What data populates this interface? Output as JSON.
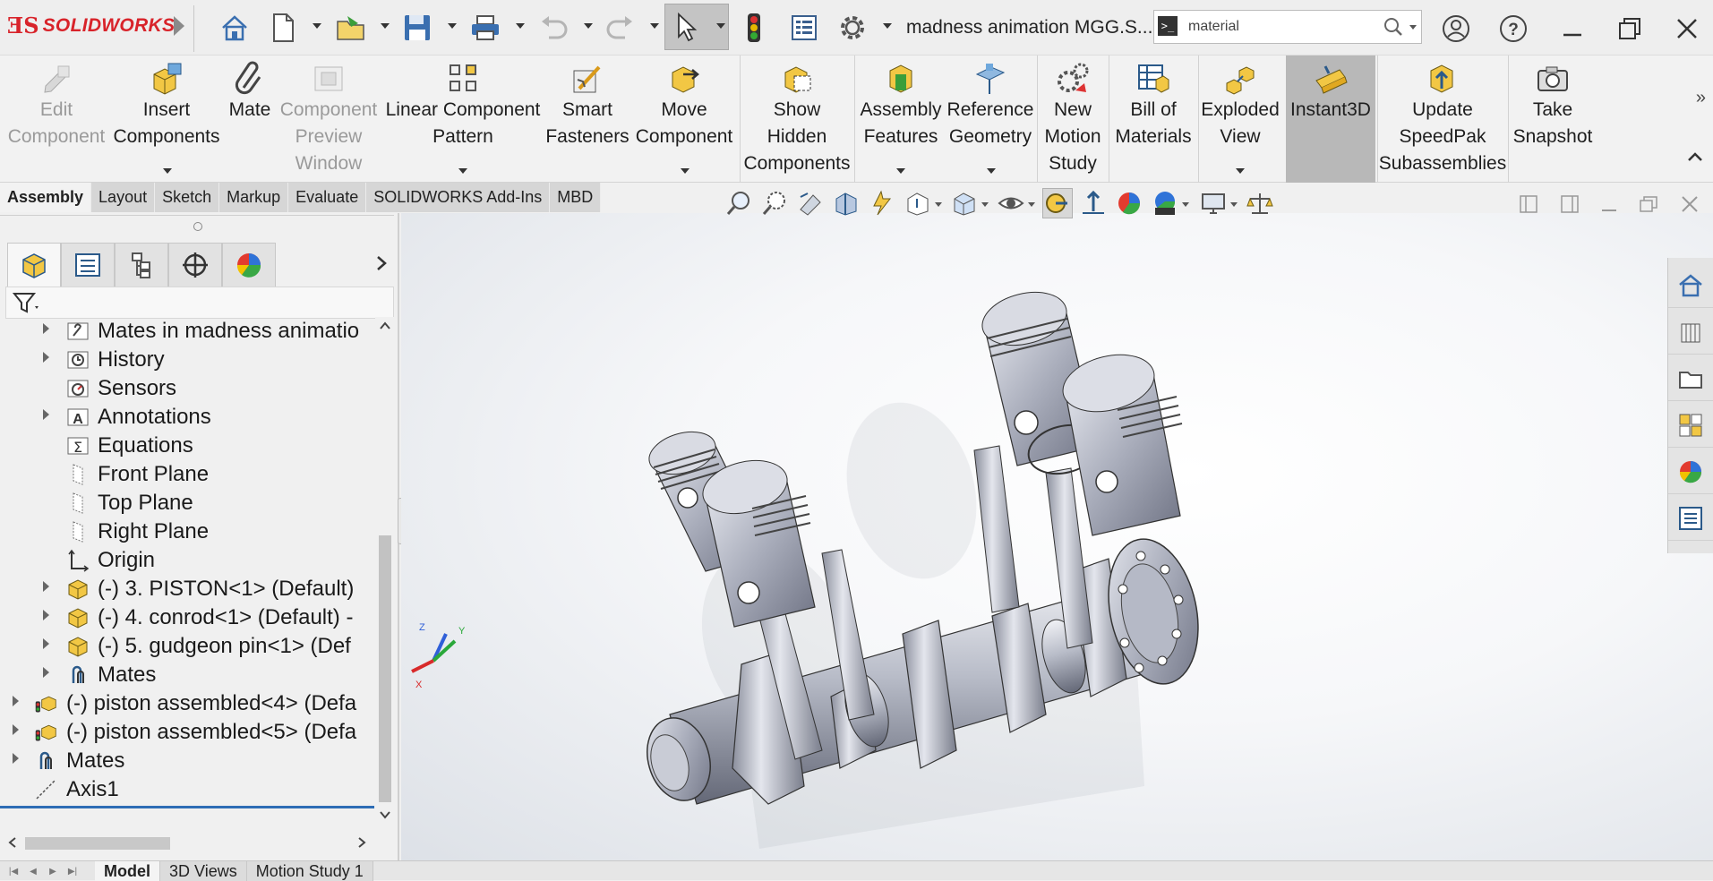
{
  "app": {
    "brand": "SOLIDWORKS",
    "document_title": "madness animation MGG.S..."
  },
  "search": {
    "value": "material",
    "placeholder": "Search"
  },
  "ribbon": {
    "items": [
      {
        "label": "Edit\nComponent",
        "disabled": true
      },
      {
        "label": "Insert\nComponents",
        "disabled": false
      },
      {
        "label": "Mate",
        "disabled": false
      },
      {
        "label": "Component\nPreview\nWindow",
        "disabled": true
      },
      {
        "label": "Linear Component\nPattern",
        "disabled": false
      },
      {
        "label": "Smart\nFasteners",
        "disabled": false
      },
      {
        "label": "Move\nComponent",
        "disabled": false
      },
      {
        "label": "Show\nHidden\nComponents",
        "disabled": false
      },
      {
        "label": "Assembly\nFeatures",
        "disabled": false
      },
      {
        "label": "Reference\nGeometry",
        "disabled": false
      },
      {
        "label": "New\nMotion\nStudy",
        "disabled": false
      },
      {
        "label": "Bill of\nMaterials",
        "disabled": false
      },
      {
        "label": "Exploded\nView",
        "disabled": false
      },
      {
        "label": "Instant3D",
        "disabled": false,
        "active": true
      },
      {
        "label": "Update\nSpeedPak\nSubassemblies",
        "disabled": false
      },
      {
        "label": "Take\nSnapshot",
        "disabled": false
      }
    ]
  },
  "cm_tabs": [
    "Assembly",
    "Layout",
    "Sketch",
    "Markup",
    "Evaluate",
    "SOLIDWORKS Add-Ins",
    "MBD"
  ],
  "tree": [
    {
      "label": "Mates in madness animatio",
      "icon": "mates-folder-icon"
    },
    {
      "label": "History",
      "icon": "history-icon"
    },
    {
      "label": "Sensors",
      "icon": "sensors-icon"
    },
    {
      "label": "Annotations",
      "icon": "annotations-icon"
    },
    {
      "label": "Equations",
      "icon": "equations-icon"
    },
    {
      "label": "Front Plane",
      "icon": "plane-icon"
    },
    {
      "label": "Top Plane",
      "icon": "plane-icon"
    },
    {
      "label": "Right Plane",
      "icon": "plane-icon"
    },
    {
      "label": "Origin",
      "icon": "origin-icon"
    },
    {
      "label": "(-) 3. PISTON<1> (Default)",
      "icon": "part-icon"
    },
    {
      "label": "(-) 4. conrod<1> (Default) -",
      "icon": "part-icon"
    },
    {
      "label": "(-) 5. gudgeon pin<1> (Def",
      "icon": "part-icon"
    },
    {
      "label": "Mates",
      "icon": "mates-icon"
    },
    {
      "label": "(-) piston assembled<4> (Defa",
      "icon": "assembly-icon"
    },
    {
      "label": "(-) piston assembled<5> (Defa",
      "icon": "assembly-icon"
    },
    {
      "label": "Mates",
      "icon": "mates-icon"
    },
    {
      "label": "Axis1",
      "icon": "axis-icon"
    }
  ],
  "triad": {
    "x": "X",
    "y": "Y",
    "z": "Z"
  },
  "bottom_tabs": [
    "Model",
    "3D Views",
    "Motion Study 1"
  ],
  "colors": {
    "brand_red": "#d8232a",
    "selection_blue": "#2e6db5",
    "active_ribbon": "#b8b8b8"
  }
}
